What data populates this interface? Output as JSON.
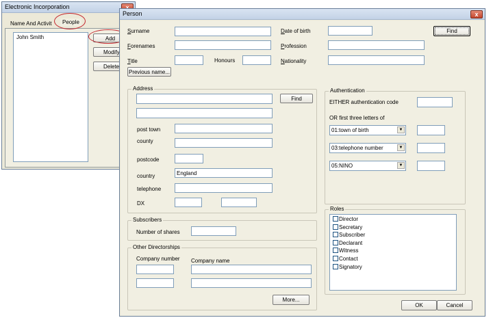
{
  "bg_window": {
    "title": "Electronic Incorporation",
    "close": "x",
    "tabs": [
      "Name And Activit",
      "People"
    ],
    "people_list": [
      "John Smith"
    ],
    "buttons": [
      "Add",
      "Modify",
      "Delete"
    ]
  },
  "person": {
    "title": "Person",
    "close": "x",
    "labels": {
      "surname": "Surname",
      "forenames": "Forenames",
      "title": "Title",
      "honours": "Honours",
      "dob": "Date of birth",
      "profession": "Profession",
      "nationality": "Nationality"
    },
    "find": "Find",
    "previous_name": "Previous name...",
    "address": {
      "title": "Address",
      "find": "Find",
      "post_town": "post town",
      "county": "county",
      "postcode": "postcode",
      "country": "country",
      "country_value": "England",
      "telephone": "telephone",
      "dx": "DX"
    },
    "subscribers": {
      "title": "Subscribers",
      "number_of_shares": "Number of shares"
    },
    "directorships": {
      "title": "Other Directorships",
      "company_number": "Company number",
      "company_name": "Company name",
      "more": "More..."
    },
    "authentication": {
      "title": "Authentication",
      "either": "EITHER authentication code",
      "or": "OR first three letters of",
      "options": [
        "01:town of birth",
        "03:telephone number",
        "05:NINO"
      ]
    },
    "roles": {
      "title": "Roles",
      "items": [
        "Director",
        "Secretary",
        "Subscriber",
        "Declarant",
        "Witness",
        "Contact",
        "Signatory"
      ]
    },
    "ok": "OK",
    "cancel": "Cancel"
  },
  "colors": {
    "highlight_oval": "#c4262e",
    "input_border": "#7f9db9",
    "dialog_bg": "#f1efe2"
  }
}
